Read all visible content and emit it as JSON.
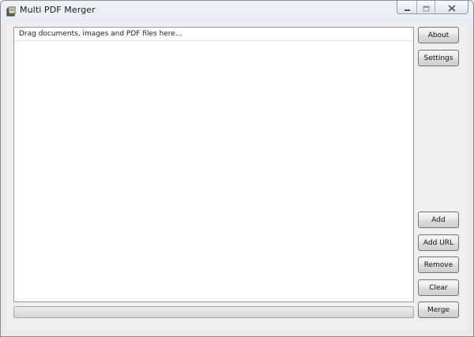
{
  "window": {
    "title": "Multi PDF Merger",
    "icon": "pdf-app-icon"
  },
  "caption": {
    "minimize_icon": "minimize-icon",
    "maximize_icon": "maximize-icon",
    "close_icon": "close-icon"
  },
  "drop_area": {
    "hint": "Drag documents, images and PDF files here..."
  },
  "progress": {
    "value": 0
  },
  "buttons": {
    "about": "About",
    "settings": "Settings",
    "add": "Add",
    "add_url": "Add URL",
    "remove": "Remove",
    "clear": "Clear",
    "merge": "Merge"
  },
  "colors": {
    "window_bg": "#efefef",
    "list_bg": "#ffffff"
  }
}
